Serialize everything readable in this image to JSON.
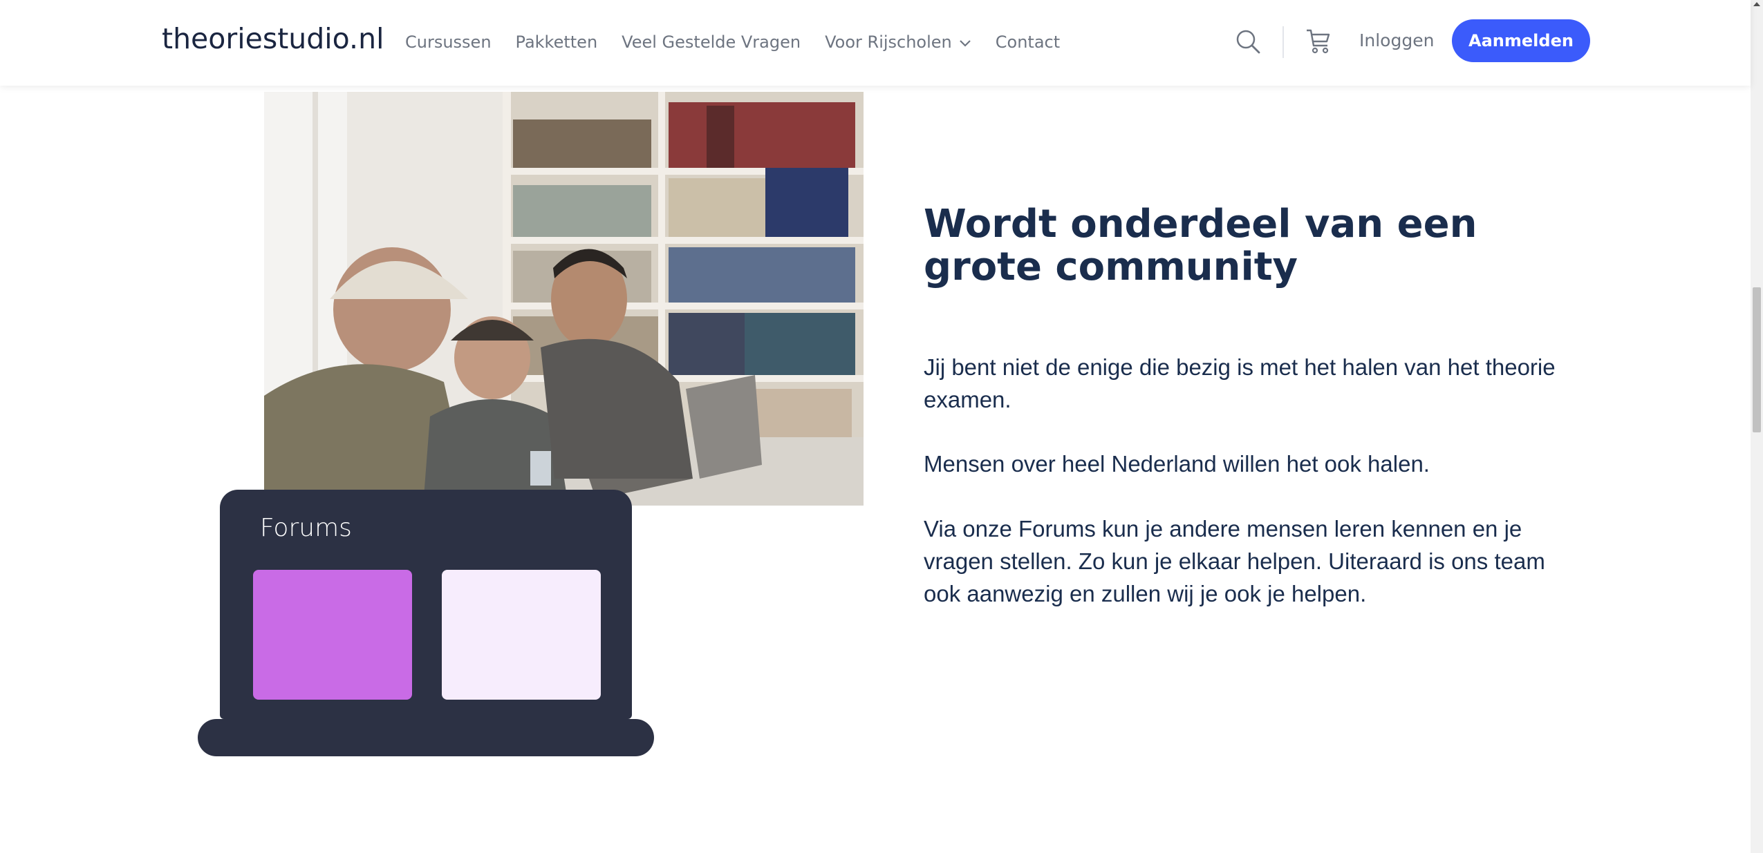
{
  "header": {
    "logo": "theoriestudio.nl",
    "nav": [
      {
        "label": "Cursussen"
      },
      {
        "label": "Pakketten"
      },
      {
        "label": "Veel Gestelde Vragen"
      },
      {
        "label": "Voor Rijscholen",
        "has_dropdown": true
      },
      {
        "label": "Contact"
      }
    ],
    "login_label": "Inloggen",
    "signup_label": "Aanmelden",
    "icons": [
      "search-icon",
      "cart-icon",
      "chevron-down-icon"
    ]
  },
  "colors": {
    "primary_button": "#3b5bfb",
    "heading_text": "#1a2d4d",
    "laptop": "#2c3144",
    "card_purple": "#c96be6",
    "card_light": "#f7edfd"
  },
  "illustration": {
    "forums_title": "Forums"
  },
  "content": {
    "heading": "Wordt onderdeel van een grote community",
    "paragraphs": [
      "Jij bent niet de enige die bezig is met het halen van het theorie examen.",
      "Mensen over heel Nederland willen het ook halen.",
      "Via onze Forums kun je andere mensen leren kennen en je vragen stellen. Zo kun je elkaar helpen. Uiteraard is ons team ook aanwezig en zullen wij je ook je helpen."
    ]
  }
}
